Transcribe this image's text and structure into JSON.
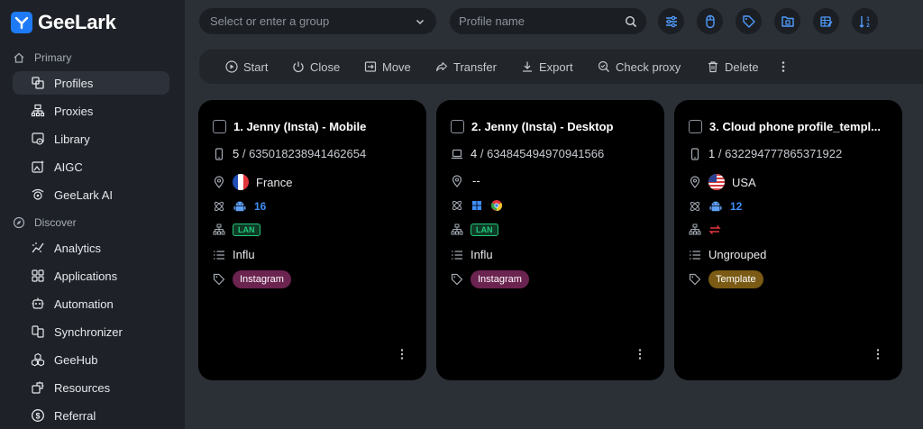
{
  "app": {
    "name": "GeeLark"
  },
  "sidebar": {
    "primary_label": "Primary",
    "discover_label": "Discover",
    "primary_items": [
      {
        "label": "Profiles",
        "icon": "profiles-icon",
        "active": true
      },
      {
        "label": "Proxies",
        "icon": "proxies-icon"
      },
      {
        "label": "Library",
        "icon": "library-icon"
      },
      {
        "label": "AIGC",
        "icon": "aigc-icon"
      },
      {
        "label": "GeeLark AI",
        "icon": "geelark-ai-icon"
      }
    ],
    "discover_items": [
      {
        "label": "Analytics",
        "icon": "analytics-icon"
      },
      {
        "label": "Applications",
        "icon": "applications-icon"
      },
      {
        "label": "Automation",
        "icon": "automation-icon"
      },
      {
        "label": "Synchronizer",
        "icon": "synchronizer-icon"
      },
      {
        "label": "GeeHub",
        "icon": "geehub-icon"
      },
      {
        "label": "Resources",
        "icon": "resources-icon"
      },
      {
        "label": "Referral",
        "icon": "referral-icon"
      }
    ]
  },
  "topbar": {
    "group_placeholder": "Select or enter a group",
    "search_placeholder": "Profile name"
  },
  "actions": {
    "start": "Start",
    "close": "Close",
    "move": "Move",
    "transfer": "Transfer",
    "export": "Export",
    "check_proxy": "Check proxy",
    "delete": "Delete"
  },
  "profiles": [
    {
      "title": "1. Jenny (Insta) - Mobile",
      "device_type": "mobile",
      "id_number": "5",
      "id": "635018238941462654",
      "location": "France",
      "platform_version": "16",
      "network": "LAN",
      "group": "Influ",
      "tag": "Instagram",
      "tag_color": "#6b2350"
    },
    {
      "title": "2. Jenny (Insta) - Desktop",
      "device_type": "desktop",
      "id_number": "4",
      "id": "634845494970941566",
      "location": "--",
      "network": "LAN",
      "group": "Influ",
      "tag": "Instagram",
      "tag_color": "#6b2350"
    },
    {
      "title": "3. Cloud phone profile_templ...",
      "device_type": "mobile",
      "id_number": "1",
      "id": "632294777865371922",
      "location": "USA",
      "platform_version": "12",
      "group": "Ungrouped",
      "tag": "Template",
      "tag_color": "#7a5a14"
    }
  ],
  "colors": {
    "accent": "#1f7af5",
    "lan_green": "#21c87a",
    "android_blue": "#3f8ef7"
  }
}
